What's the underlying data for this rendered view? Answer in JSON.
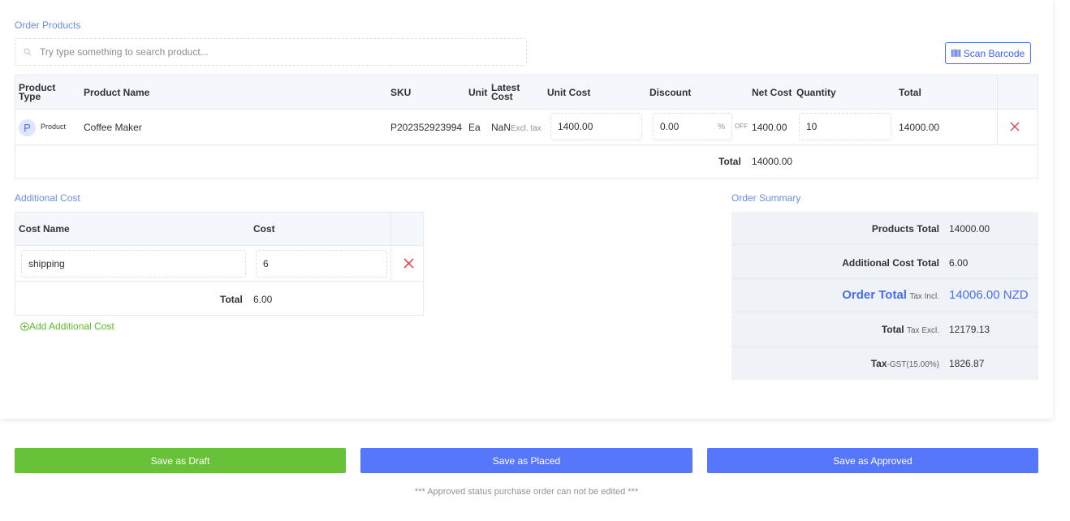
{
  "order_products": {
    "section_label": "Order Products",
    "search_placeholder": "Try type something to search product...",
    "scan_button_label": "Scan Barcode",
    "headers": {
      "product_type": "Product Type",
      "product_name": "Product Name",
      "sku": "SKU",
      "unit": "Unit",
      "latest_cost": "Latest Cost",
      "unit_cost": "Unit Cost",
      "discount": "Discount",
      "net_cost": "Net Cost",
      "quantity": "Quantity",
      "total": "Total"
    },
    "rows": [
      {
        "type_initial": "P",
        "type_label": "Product",
        "name": "Coffee Maker",
        "sku": "P202352923994",
        "unit": "Ea",
        "latest_cost": "NaN",
        "latest_cost_note": "Excl. tax",
        "unit_cost": "1400.00",
        "discount": "0.00",
        "discount_unit": "%",
        "discount_suffix": "OFF",
        "net_cost": "1400.00",
        "quantity": "10",
        "total": "14000.00"
      }
    ],
    "footer_total_label": "Total",
    "footer_total_value": "14000.00"
  },
  "additional_cost": {
    "section_label": "Additional Cost",
    "headers": {
      "cost_name": "Cost Name",
      "cost": "Cost"
    },
    "rows": [
      {
        "name": "shipping",
        "cost": "6"
      }
    ],
    "footer_total_label": "Total",
    "footer_total_value": "6.00",
    "add_link_label": "Add Additional Cost"
  },
  "order_summary": {
    "section_label": "Order Summary",
    "rows": [
      {
        "label": "Products Total",
        "sub": "",
        "value": "14000.00"
      },
      {
        "label": "Additional Cost Total",
        "sub": "",
        "value": "6.00"
      },
      {
        "label": "Order Total",
        "sub": "Tax Incl.",
        "value": "14006.00 NZD"
      },
      {
        "label": "Total",
        "sub": "Tax Excl.",
        "value": "12179.13"
      },
      {
        "label": "Tax",
        "sub": "-GST(15.00%)",
        "value": "1826.87"
      }
    ]
  },
  "actions": {
    "save_draft": "Save as Draft",
    "save_placed": "Save as Placed",
    "save_approved": "Save as Approved",
    "note": "*** Approved status purchase order can not be edited ***"
  },
  "colors": {
    "accent_blue": "#4a6cf0",
    "button_blue": "#5677f9",
    "button_green": "#67c23a",
    "remove_red": "#e5484d",
    "section_label": "#6a8ee0"
  }
}
